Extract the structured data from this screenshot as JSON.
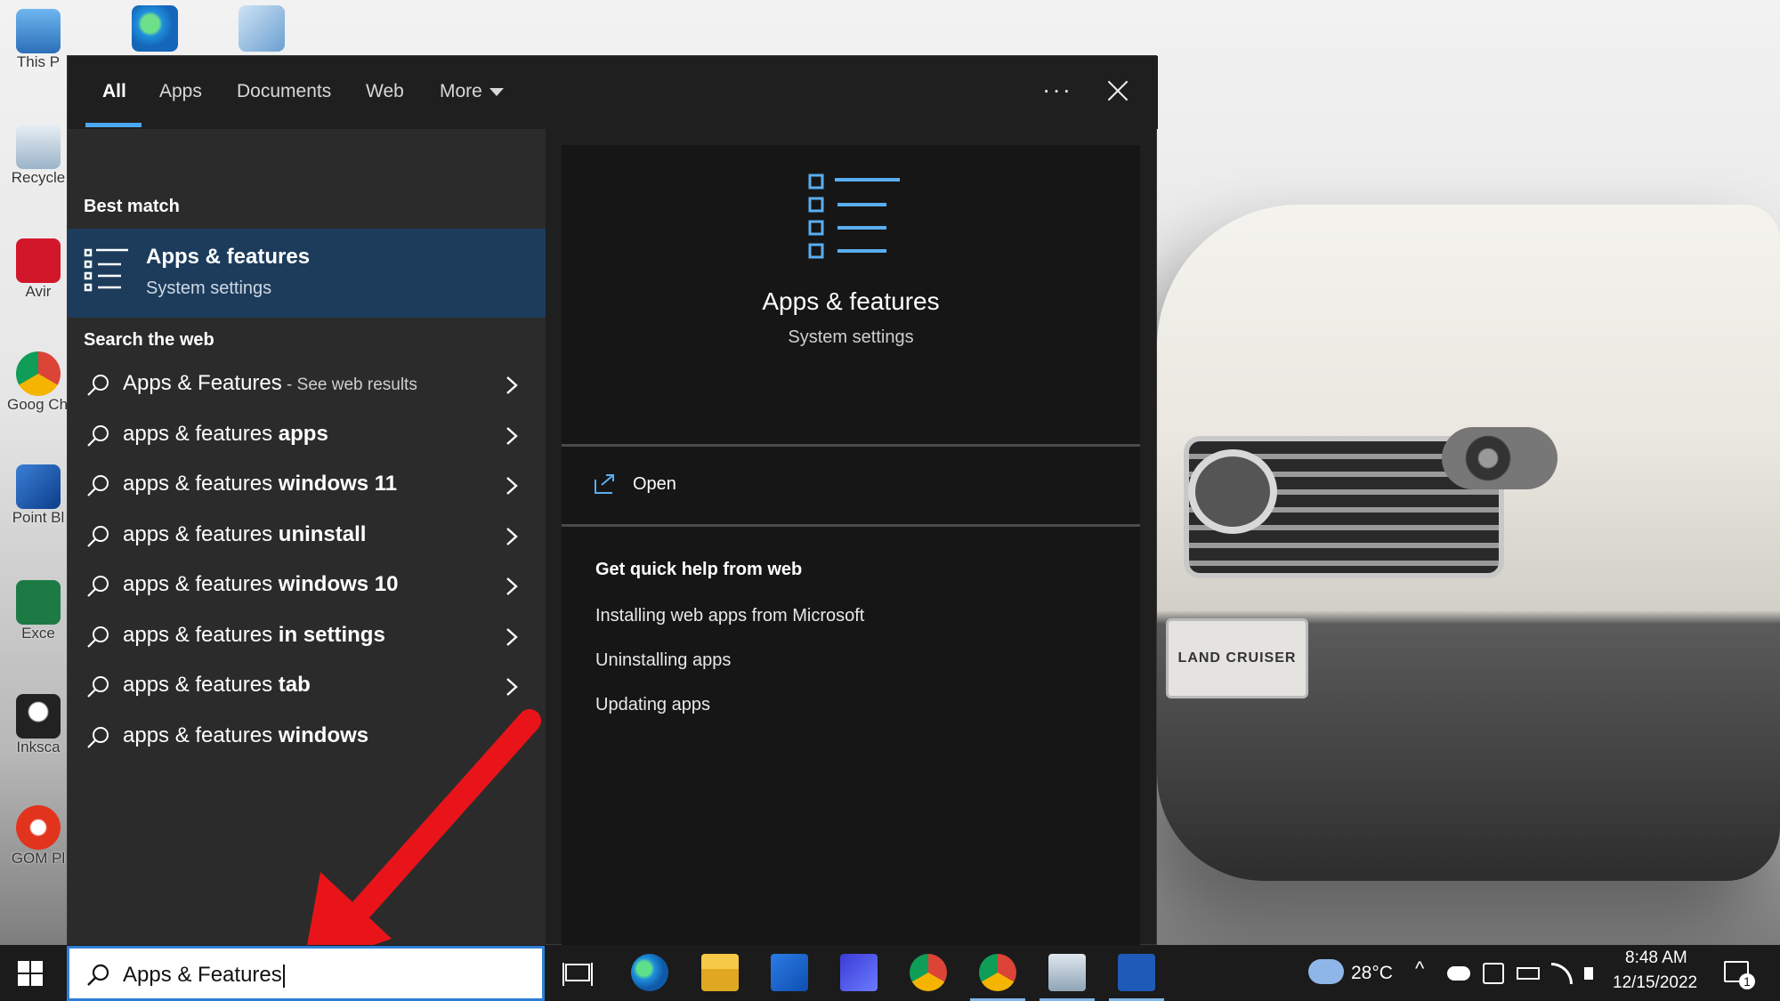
{
  "desktop": {
    "icons": [
      {
        "name": "this-pc",
        "label": "This P"
      },
      {
        "name": "recycle-bin",
        "label": "Recycle"
      },
      {
        "name": "avira",
        "label": "Avir"
      },
      {
        "name": "google-chrome",
        "label": "Goog Chron"
      },
      {
        "name": "point-blank",
        "label": "Point Bl"
      },
      {
        "name": "excel",
        "label": "Exce"
      },
      {
        "name": "inkscape",
        "label": "Inksca"
      },
      {
        "name": "gom-player",
        "label": "GOM Pl"
      }
    ],
    "plate_text": "LAND CRUISER"
  },
  "tabs": [
    "All",
    "Apps",
    "Documents",
    "Web",
    "More"
  ],
  "best_match": {
    "heading": "Best match",
    "title": "Apps & features",
    "subtitle": "System settings"
  },
  "web": {
    "heading": "Search the web",
    "results": [
      {
        "prefix": "Apps & Features",
        "bold": "",
        "suffix": " - See web results"
      },
      {
        "prefix": "apps & features ",
        "bold": "apps",
        "suffix": ""
      },
      {
        "prefix": "apps & features ",
        "bold": "windows 11",
        "suffix": ""
      },
      {
        "prefix": "apps & features ",
        "bold": "uninstall",
        "suffix": ""
      },
      {
        "prefix": "apps & features ",
        "bold": "windows 10",
        "suffix": ""
      },
      {
        "prefix": "apps & features ",
        "bold": "in settings",
        "suffix": ""
      },
      {
        "prefix": "apps & features ",
        "bold": "tab",
        "suffix": ""
      },
      {
        "prefix": "apps & features ",
        "bold": "windows",
        "suffix": ""
      }
    ]
  },
  "preview": {
    "title": "Apps & features",
    "subtitle": "System settings",
    "open_label": "Open",
    "help_heading": "Get quick help from web",
    "help_links": [
      "Installing web apps from Microsoft",
      "Uninstalling apps",
      "Updating apps"
    ]
  },
  "search": {
    "value": "Apps & Features"
  },
  "tray": {
    "temperature": "28°C",
    "time": "8:48 AM",
    "date": "12/15/2022",
    "notifications": "1"
  },
  "colors": {
    "accent": "#4ca8f0",
    "selected_bg": "#1d3c5c",
    "arrow": "#e8141a"
  }
}
